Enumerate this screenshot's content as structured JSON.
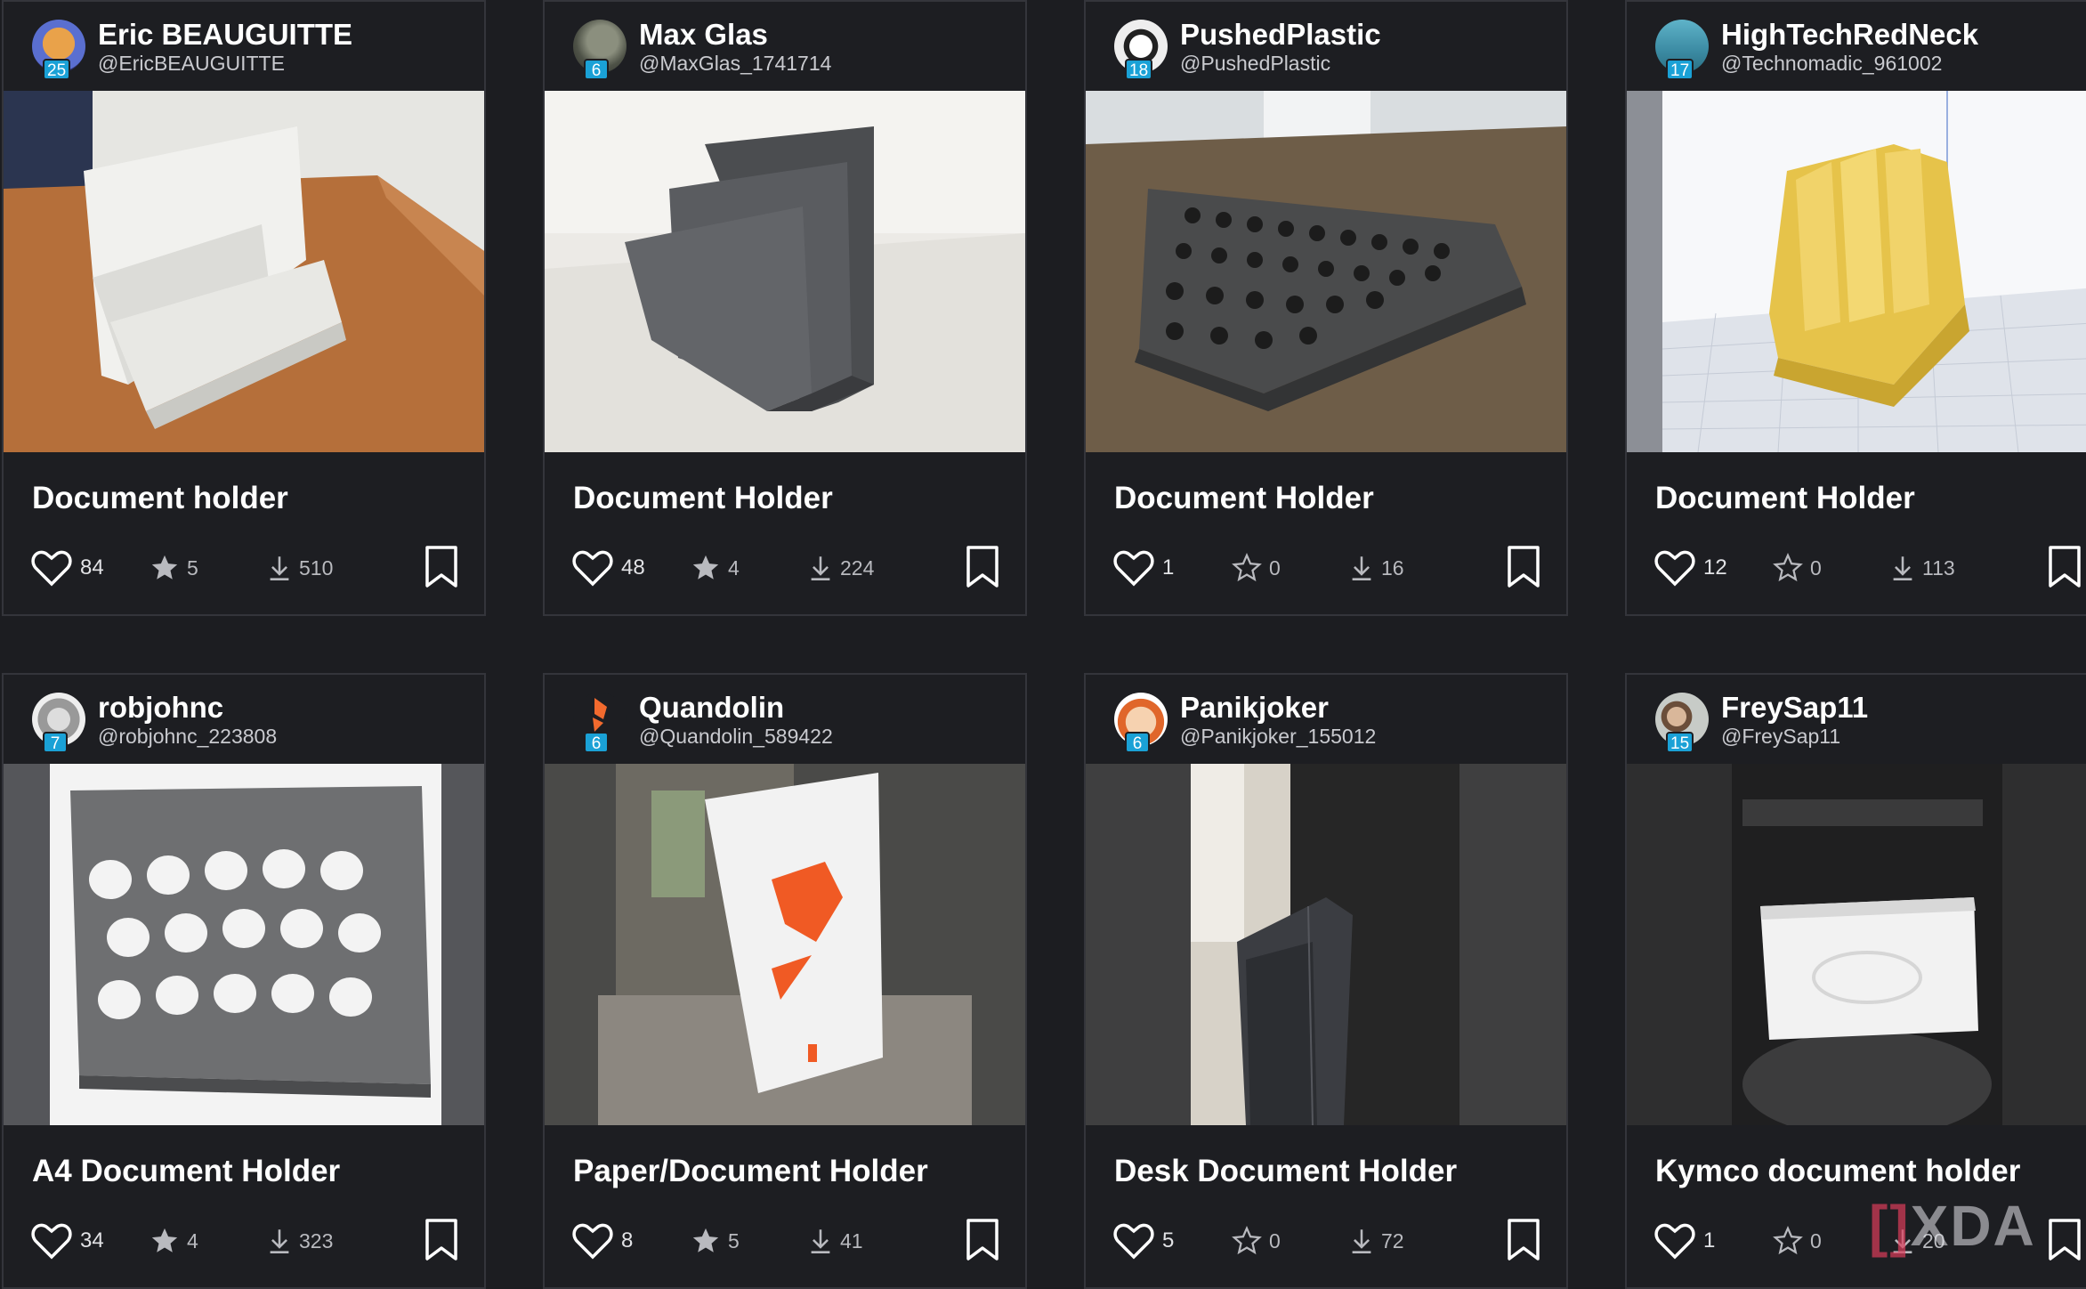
{
  "cards": [
    {
      "name": "Eric BEAUGUITTE",
      "handle": "@EricBEAUGUITTE",
      "level": "25",
      "title": "Document holder",
      "likes": "84",
      "stars": "5",
      "downloads": "510",
      "star_filled": true
    },
    {
      "name": "Max Glas",
      "handle": "@MaxGlas_1741714",
      "level": "6",
      "title": "Document Holder",
      "likes": "48",
      "stars": "4",
      "downloads": "224",
      "star_filled": true
    },
    {
      "name": "PushedPlastic",
      "handle": "@PushedPlastic",
      "level": "18",
      "title": "Document Holder",
      "likes": "1",
      "stars": "0",
      "downloads": "16",
      "star_filled": false
    },
    {
      "name": "HighTechRedNeck",
      "handle": "@Technomadic_961002",
      "level": "17",
      "title": "Document Holder",
      "likes": "12",
      "stars": "0",
      "downloads": "113",
      "star_filled": false
    },
    {
      "name": "robjohnc",
      "handle": "@robjohnc_223808",
      "level": "7",
      "title": "A4 Document Holder",
      "likes": "34",
      "stars": "4",
      "downloads": "323",
      "star_filled": true
    },
    {
      "name": "Quandolin",
      "handle": "@Quandolin_589422",
      "level": "6",
      "title": "Paper/Document Holder",
      "likes": "8",
      "stars": "5",
      "downloads": "41",
      "star_filled": true
    },
    {
      "name": "Panikjoker",
      "handle": "@Panikjoker_155012",
      "level": "6",
      "title": "Desk Document Holder",
      "likes": "5",
      "stars": "0",
      "downloads": "72",
      "star_filled": false
    },
    {
      "name": "FreySap11",
      "handle": "@FreySap11",
      "level": "15",
      "title": "Kymco document holder",
      "likes": "1",
      "stars": "0",
      "downloads": "20",
      "star_filled": false
    }
  ],
  "watermark": {
    "bracket": "[]",
    "text": "XDA"
  },
  "colors": {
    "background": "#1c1d21",
    "card": "#1d1e22",
    "border": "#34353b",
    "level_badge": "#1aa1d6",
    "text_muted": "#b9babf"
  }
}
